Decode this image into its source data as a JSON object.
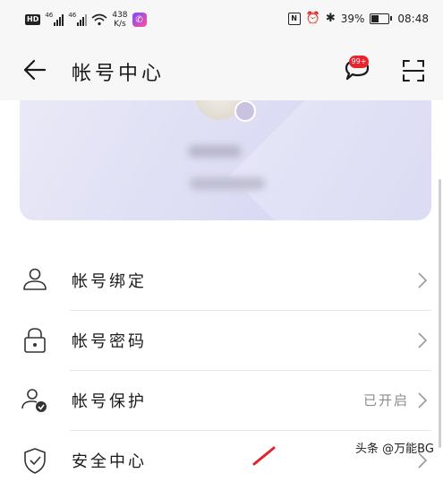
{
  "status_bar": {
    "hd_badge": "HD",
    "signal1_gen": "46",
    "signal2_gen": "46",
    "net_speed_value": "438",
    "net_speed_unit": "K/s",
    "battery_percent": "39%",
    "time": "08:48",
    "battery_level": 0.39
  },
  "header": {
    "title": "帐号中心",
    "message_badge": "99+",
    "icons": {
      "back": "back-arrow-icon",
      "message": "message-bubble-icon",
      "scan": "scan-icon"
    }
  },
  "menu": [
    {
      "label": "帐号绑定",
      "status": "",
      "icon": "person-icon"
    },
    {
      "label": "帐号密码",
      "status": "",
      "icon": "lock-icon"
    },
    {
      "label": "帐号保护",
      "status": "已开启",
      "icon": "person-shield-icon"
    },
    {
      "label": "安全中心",
      "status": "",
      "icon": "shield-check-icon"
    }
  ],
  "watermark": "头条 @万能BG",
  "colors": {
    "badge_red": "#e8242c",
    "card_tint": "#dcdcf4"
  }
}
